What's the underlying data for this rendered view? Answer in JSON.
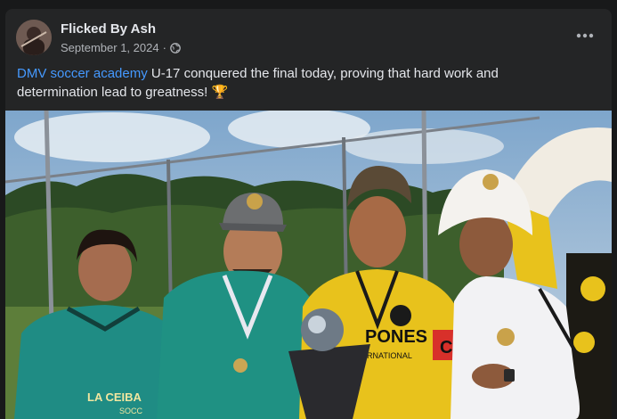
{
  "post": {
    "author": "Flicked By Ash",
    "date": "September 1, 2024",
    "separator": "·",
    "privacy_icon": "globe-icon",
    "more_icon": "more-options-icon",
    "caption_tag": "DMV soccer academy",
    "caption_text": "U-17 conquered the final today, proving that hard work and determination lead to greatness!",
    "caption_emoji": "🏆"
  },
  "photo": {
    "jersey_text_left": "LA CEIBA",
    "jersey_text_left_sub": "SOCC",
    "jersey_text_center": "PONES",
    "jersey_text_center_sub": "ERNATIONAL",
    "captain_band": "C"
  },
  "colors": {
    "background": "#18191a",
    "card": "#242526",
    "link": "#4599ff",
    "text": "#e4e6eb",
    "muted": "#b0b3b8"
  }
}
